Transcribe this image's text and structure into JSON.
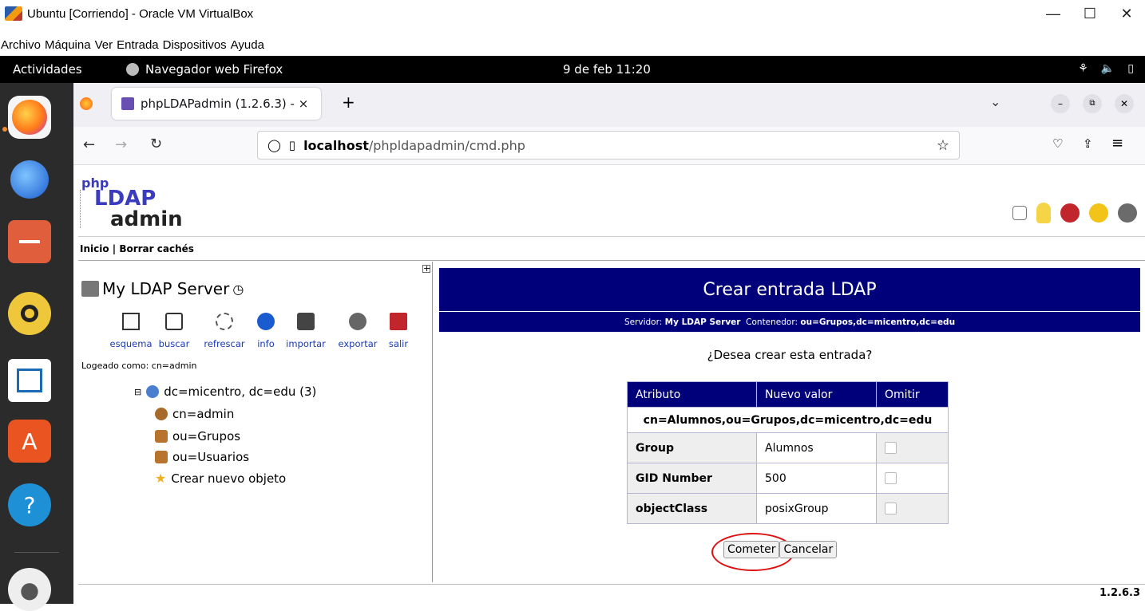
{
  "vbox": {
    "title": "Ubuntu [Corriendo] - Oracle VM VirtualBox",
    "menu": [
      "Archivo",
      "Máquina",
      "Ver",
      "Entrada",
      "Dispositivos",
      "Ayuda"
    ],
    "minimize": "—",
    "maximize": "☐",
    "close": "✕"
  },
  "gnome": {
    "activities": "Actividades",
    "app": "Navegador web Firefox",
    "clock": "9 de feb  11:20"
  },
  "firefox": {
    "tab_title": "phpLDAPadmin (1.2.6.3) - ×",
    "new_tab": "+",
    "url_host": "localhost",
    "url_path": "/phpldapadmin/cmd.php"
  },
  "page": {
    "logo": {
      "php": "php",
      "ldap": "LDAP",
      "admin": "admin"
    },
    "toplinks": "Inicio | Borrar cachés",
    "server_name": "My LDAP Server",
    "toolbar": [
      "esquema",
      "buscar",
      "refrescar",
      "info",
      "importar",
      "exportar",
      "salir"
    ],
    "logged_as": "Logeado como: cn=admin",
    "tree": {
      "root": "dc=micentro, dc=edu (3)",
      "children": [
        "cn=admin",
        "ou=Grupos",
        "ou=Usuarios",
        "Crear nuevo objeto"
      ]
    },
    "title": "Crear entrada LDAP",
    "sub": {
      "server_label": "Servidor:",
      "server": "My LDAP Server",
      "container_label": "Contenedor:",
      "container": "ou=Grupos,dc=micentro,dc=edu"
    },
    "question": "¿Desea crear esta entrada?",
    "table": {
      "headers": [
        "Atributo",
        "Nuevo valor",
        "Omitir"
      ],
      "dn": "cn=Alumnos,ou=Grupos,dc=micentro,dc=edu",
      "rows": [
        {
          "attr": "Group",
          "value": "Alumnos"
        },
        {
          "attr": "GID Number",
          "value": "500"
        },
        {
          "attr": "objectClass",
          "value": "posixGroup"
        }
      ]
    },
    "buttons": {
      "commit": "Cometer",
      "cancel": "Cancelar"
    },
    "version": "1.2.6.3"
  }
}
